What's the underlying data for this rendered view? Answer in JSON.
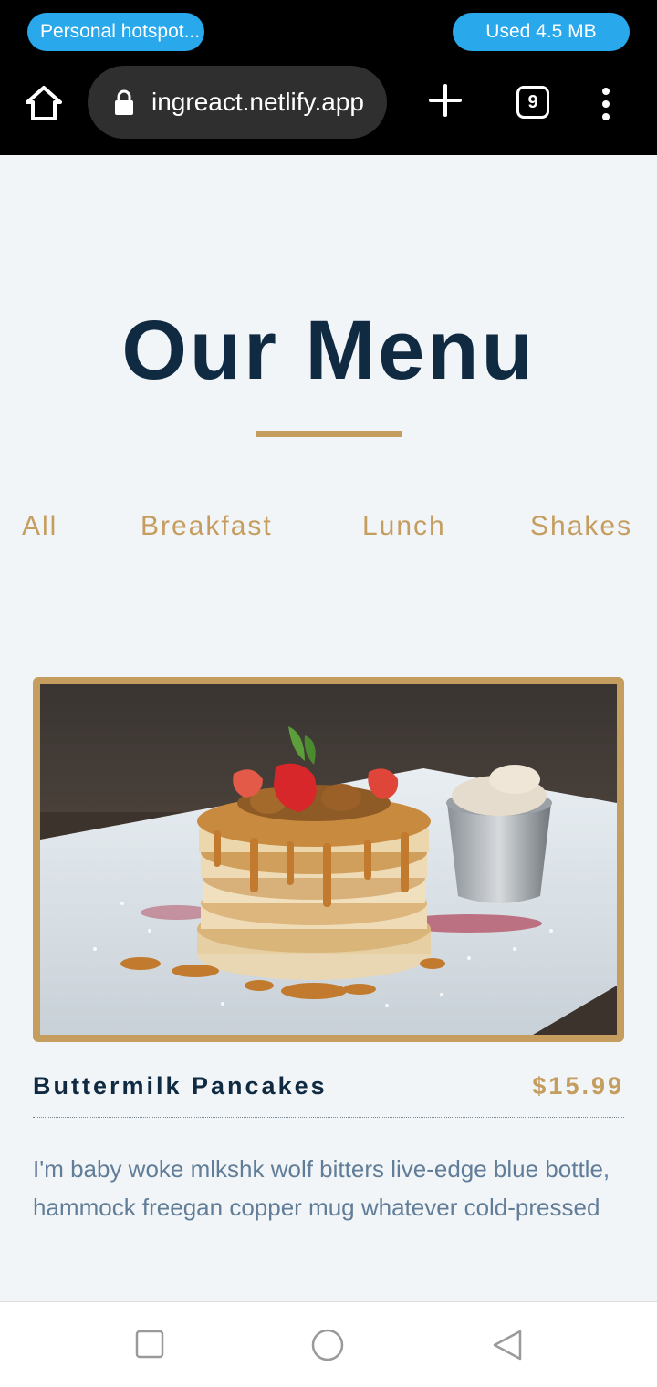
{
  "status": {
    "hotspot": "Personal hotspot...",
    "used": "Used  4.5 MB"
  },
  "browser": {
    "url": "ingreact.netlify.app",
    "tab_count": "9",
    "icons": [
      "home-icon",
      "lock-icon",
      "plus-icon",
      "tabs-icon",
      "more-vert-icon"
    ]
  },
  "menu": {
    "title": "Our Menu",
    "filters": [
      "All",
      "Breakfast",
      "Lunch",
      "Shakes"
    ],
    "items": [
      {
        "name": "Buttermilk Pancakes",
        "price": "$15.99",
        "description": "I'm baby woke mlkshk wolf bitters live-edge blue bottle, hammock freegan copper mug whatever cold-pressed"
      }
    ]
  },
  "colors": {
    "primary": "#102a42",
    "accent": "#c59d5f",
    "text": "#617d98",
    "background": "#f1f5f8",
    "hotspot_pill": "#29a8ec"
  },
  "navbar": {
    "icons": [
      "recent-apps-icon",
      "home-circle-icon",
      "back-triangle-icon"
    ]
  }
}
